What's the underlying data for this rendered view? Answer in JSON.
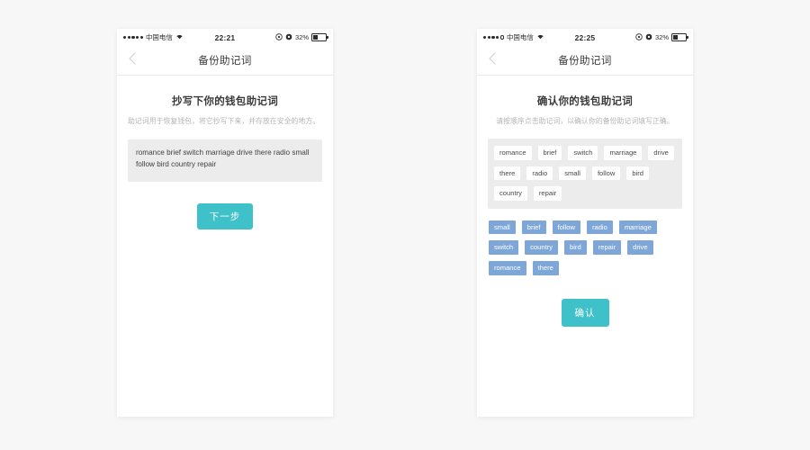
{
  "screens": [
    {
      "id": "backup-mnemonic-write",
      "status_bar": {
        "carrier": "中国电信",
        "signal_dots": 5,
        "signal_filled": 5,
        "wifi_icon": "wifi-icon",
        "time": "22:21",
        "alarm_icon": "alarm-icon",
        "rotation_lock_icon": "rotation-lock-icon",
        "battery_percent": "32%",
        "battery_level": 32
      },
      "nav": {
        "back_icon": "chevron-left-icon",
        "title": "备份助记词"
      },
      "title": "抄写下你的钱包助记词",
      "subtitle": "助记词用于恢复钱包，将它抄写下来，并存放在安全的地方。",
      "mnemonic_text": "romance brief switch marriage drive there radio small follow bird country repair",
      "primary_button": "下一步"
    },
    {
      "id": "backup-mnemonic-confirm",
      "status_bar": {
        "carrier": "中国电信",
        "signal_dots": 5,
        "signal_filled": 4,
        "wifi_icon": "wifi-icon",
        "time": "22:25",
        "alarm_icon": "alarm-icon",
        "rotation_lock_icon": "rotation-lock-icon",
        "battery_percent": "32%",
        "battery_level": 32
      },
      "nav": {
        "back_icon": "chevron-left-icon",
        "title": "备份助记词"
      },
      "title": "确认你的钱包助记词",
      "subtitle": "请按顺序点击助记词，以确认你的备份助记词填写正确。",
      "word_pool": [
        "romance",
        "brief",
        "switch",
        "marriage",
        "drive",
        "there",
        "radio",
        "small",
        "follow",
        "bird",
        "country",
        "repair"
      ],
      "selected_words": [
        "small",
        "brief",
        "follow",
        "radio",
        "marriage",
        "switch",
        "country",
        "bird",
        "repair",
        "drive",
        "romance",
        "there"
      ],
      "primary_button": "确认"
    }
  ],
  "colors": {
    "page_background": "#f7f7f7",
    "accent_teal": "#3fc1c9",
    "chip_selected_blue": "#7ea7d8",
    "panel_gray": "#ececec"
  }
}
